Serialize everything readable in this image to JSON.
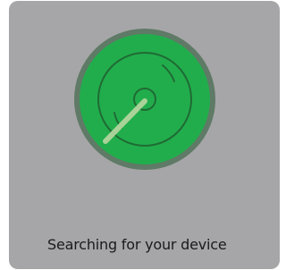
{
  "status": {
    "text": "Searching for your device"
  },
  "colors": {
    "card_background": "#a6a6a8",
    "radar_fill": "#22ad4c",
    "radar_border": "#5f7a66",
    "radar_lines": "#1f6b34",
    "sweep": "#b9d8a2"
  },
  "icons": {
    "radar": "radar-scan-icon"
  }
}
